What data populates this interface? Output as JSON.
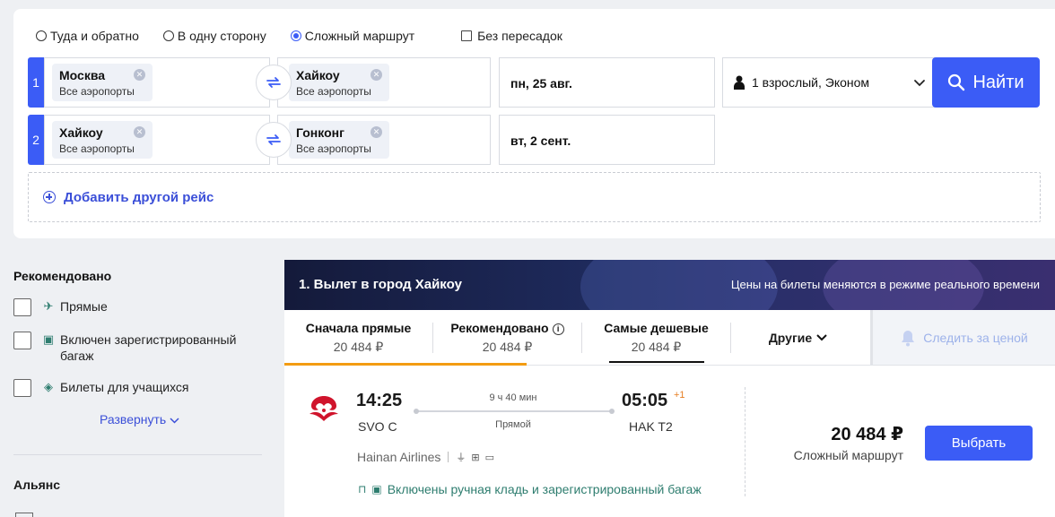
{
  "trip_types": [
    {
      "label": "Туда и обратно",
      "checked": false
    },
    {
      "label": "В одну сторону",
      "checked": false
    },
    {
      "label": "Сложный маршрут",
      "checked": true
    }
  ],
  "nonstop_label": "Без пересадок",
  "legs": [
    {
      "num": "1",
      "from": {
        "city": "Москва",
        "sub": "Все аэропорты"
      },
      "to": {
        "city": "Хайкоу",
        "sub": "Все аэропорты"
      },
      "date": "пн, 25 авг."
    },
    {
      "num": "2",
      "from": {
        "city": "Хайкоу",
        "sub": "Все аэропорты"
      },
      "to": {
        "city": "Гонконг",
        "sub": "Все аэропорты"
      },
      "date": "вт, 2 сент."
    }
  ],
  "passengers": "1 взрослый, Эконом",
  "find_label": "Найти",
  "add_leg_label": "Добавить другой рейс",
  "filters": {
    "recommended_title": "Рекомендовано",
    "items": [
      {
        "label": "Прямые",
        "icon": "plane-icon"
      },
      {
        "label": "Включен зарегистрированный багаж",
        "icon": "luggage-icon"
      },
      {
        "label": "Билеты для учащихся",
        "icon": "student-icon"
      }
    ],
    "expand_label": "Развернуть",
    "alliance_title": "Альянс"
  },
  "results": {
    "banner_title": "1. Вылет в город Хайкоу",
    "banner_note": "Цены на билеты меняются в режиме реального времени",
    "tabs": [
      {
        "label": "Сначала прямые",
        "price": "20 484 ₽"
      },
      {
        "label": "Рекомендовано",
        "price": "20 484 ₽"
      },
      {
        "label": "Самые дешевые",
        "price": "20 484 ₽"
      }
    ],
    "others_label": "Другие",
    "watch_label": "Следить за ценой"
  },
  "ticket": {
    "dep_time": "14:25",
    "dep_code": "SVO C",
    "duration": "9 ч 40 мин",
    "stops": "Прямой",
    "arr_time": "05:05",
    "arr_plus": "+1",
    "arr_code": "HAK T2",
    "airline": "Hainan Airlines",
    "baggage_text": "Включены ручная кладь и зарегистрированный багаж",
    "price": "20 484 ₽",
    "price_sub": "Сложный маршрут",
    "select_label": "Выбрать"
  },
  "colors": {
    "accent": "#3b5cf6",
    "link": "#3b4fd8",
    "progress": "#f39c12",
    "baggage": "#2e7d6f",
    "airline_red": "#d0142c"
  }
}
